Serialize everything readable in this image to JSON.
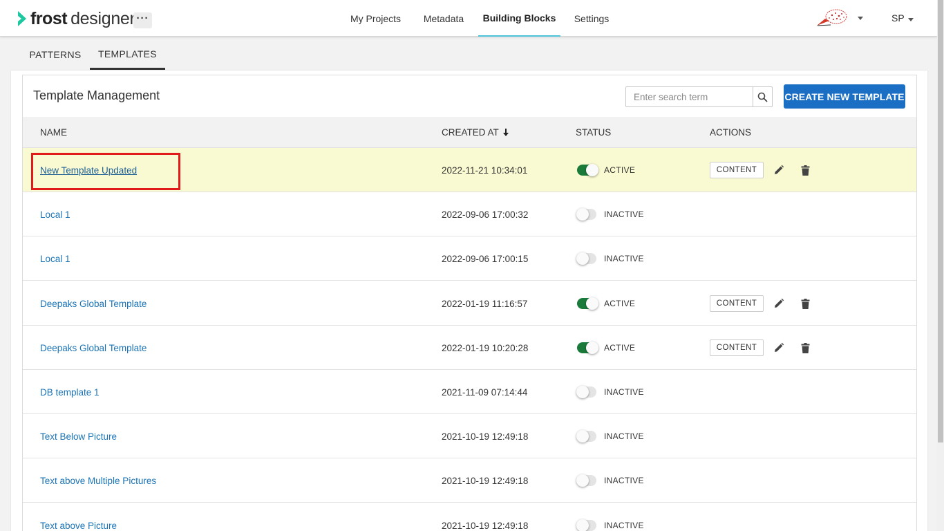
{
  "app": {
    "logo_bold": "frost",
    "logo_light": "designer",
    "more_label": "···",
    "user_initials": "SP"
  },
  "nav": {
    "items": [
      {
        "label": "My Projects",
        "active": false
      },
      {
        "label": "Metadata",
        "active": false
      },
      {
        "label": "Building Blocks",
        "active": true
      },
      {
        "label": "Settings",
        "active": false
      }
    ]
  },
  "subtabs": [
    {
      "label": "PATTERNS",
      "active": false
    },
    {
      "label": "TEMPLATES",
      "active": true
    }
  ],
  "panel": {
    "title": "Template Management",
    "search_placeholder": "Enter search term",
    "create_button": "CREATE NEW TEMPLATE"
  },
  "table": {
    "headers": {
      "name": "NAME",
      "created_at": "CREATED AT",
      "status": "STATUS",
      "actions": "ACTIONS"
    },
    "content_label": "CONTENT",
    "rows": [
      {
        "name": "New Template Updated",
        "created_at": "2022-11-21 10:34:01",
        "status": "ACTIVE",
        "active": true
      },
      {
        "name": "Local 1",
        "created_at": "2022-09-06 17:00:32",
        "status": "INACTIVE",
        "active": false
      },
      {
        "name": "Local 1",
        "created_at": "2022-09-06 17:00:15",
        "status": "INACTIVE",
        "active": false
      },
      {
        "name": "Deepaks Global Template",
        "created_at": "2022-01-19 11:16:57",
        "status": "ACTIVE",
        "active": true
      },
      {
        "name": "Deepaks Global Template",
        "created_at": "2022-01-19 10:20:28",
        "status": "ACTIVE",
        "active": true
      },
      {
        "name": "DB template 1",
        "created_at": "2021-11-09 07:14:44",
        "status": "INACTIVE",
        "active": false
      },
      {
        "name": "Text Below Picture",
        "created_at": "2021-10-19 12:49:18",
        "status": "INACTIVE",
        "active": false
      },
      {
        "name": "Text above Multiple Pictures",
        "created_at": "2021-10-19 12:49:18",
        "status": "INACTIVE",
        "active": false
      },
      {
        "name": "Text above Picture",
        "created_at": "2021-10-19 12:49:18",
        "status": "INACTIVE",
        "active": false
      }
    ]
  },
  "colors": {
    "accent_blue": "#1a6fc4",
    "nav_underline": "#4fc3d9",
    "toggle_on": "#1a7a3a",
    "link": "#1a73b5",
    "highlight_row": "#fafad2",
    "annotation_red": "#e11a1a"
  },
  "icons": {
    "logo": "chevron-logo-icon",
    "search": "search-icon",
    "sort": "arrow-down-icon",
    "edit": "pencil-icon",
    "delete": "trash-icon",
    "dropdown": "caret-down-icon"
  }
}
